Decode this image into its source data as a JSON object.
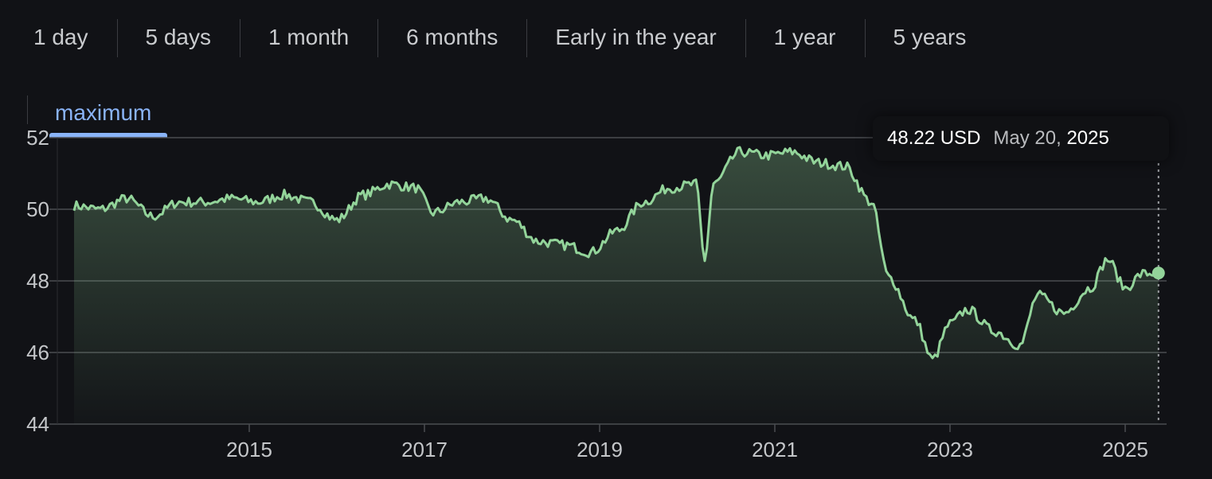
{
  "tabs": [
    {
      "label": "1 day"
    },
    {
      "label": "5 days"
    },
    {
      "label": "1 month"
    },
    {
      "label": "6 months"
    },
    {
      "label": "Early in the year"
    },
    {
      "label": "1 year"
    },
    {
      "label": "5 years"
    }
  ],
  "active_range": "maximum",
  "tooltip": {
    "price": "48.22 USD",
    "date": "May 20,",
    "year": "2025"
  },
  "colors": {
    "background": "#111216",
    "line": "#93d49a",
    "active_tab": "#8ab4f8",
    "grid": "#4a4c51"
  },
  "chart_data": {
    "type": "area",
    "title": "",
    "xlabel": "",
    "ylabel": "",
    "ylim": [
      44,
      52
    ],
    "yticks": [
      44,
      46,
      48,
      50,
      52
    ],
    "xticks": [
      "2015",
      "2017",
      "2019",
      "2021",
      "2023",
      "2025"
    ],
    "grid": true,
    "x": [
      2013.0,
      2013.3,
      2013.6,
      2013.9,
      2014.2,
      2014.5,
      2014.8,
      2015.1,
      2015.4,
      2015.7,
      2016.0,
      2016.3,
      2016.6,
      2016.9,
      2017.1,
      2017.4,
      2017.7,
      2018.0,
      2018.3,
      2018.6,
      2018.9,
      2019.2,
      2019.5,
      2019.8,
      2020.1,
      2020.2,
      2020.3,
      2020.6,
      2020.9,
      2021.2,
      2021.5,
      2021.8,
      2022.1,
      2022.3,
      2022.6,
      2022.8,
      2023.0,
      2023.2,
      2023.5,
      2023.8,
      2024.0,
      2024.3,
      2024.6,
      2024.8,
      2025.0,
      2025.2,
      2025.38
    ],
    "y": [
      50.1,
      50.0,
      50.3,
      49.8,
      50.2,
      50.2,
      50.3,
      50.2,
      50.4,
      50.2,
      49.7,
      50.4,
      50.7,
      50.6,
      49.9,
      50.2,
      50.3,
      49.7,
      49.1,
      49.0,
      48.8,
      49.4,
      50.2,
      50.6,
      50.7,
      48.6,
      50.7,
      51.6,
      51.5,
      51.6,
      51.3,
      51.2,
      50.2,
      48.1,
      46.9,
      45.8,
      46.8,
      47.2,
      46.6,
      46.2,
      47.6,
      47.1,
      47.8,
      48.6,
      47.8,
      48.2,
      48.22
    ],
    "series": [
      {
        "name": "",
        "values": []
      }
    ]
  }
}
